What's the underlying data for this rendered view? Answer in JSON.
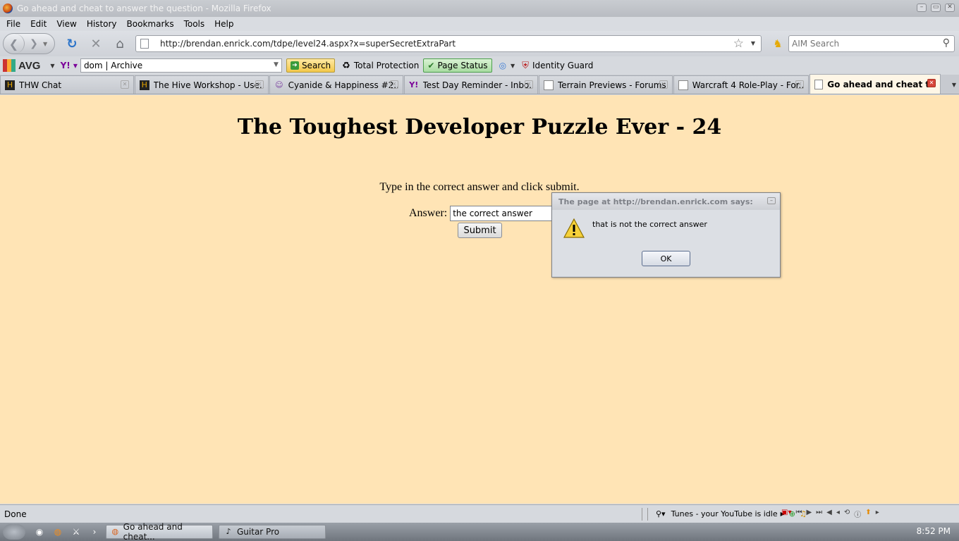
{
  "window": {
    "title": "Go ahead and cheat to answer the question - Mozilla Firefox",
    "controls": [
      "minimize",
      "restore",
      "close"
    ]
  },
  "menu": {
    "items": [
      "File",
      "Edit",
      "View",
      "History",
      "Bookmarks",
      "Tools",
      "Help"
    ]
  },
  "navbar": {
    "url": "http://brendan.enrick.com/tdpe/level24.aspx?x=superSecretExtraPart",
    "search_placeholder": "AIM Search"
  },
  "avgbar": {
    "brand": "AVG",
    "search_value": "dom | Archive",
    "search_button": "Search",
    "total_protection": "Total Protection",
    "page_status": "Page Status",
    "identity_guard": "Identity Guard"
  },
  "tabs": [
    {
      "label": "THW Chat",
      "icon": "hive-icon"
    },
    {
      "label": "The Hive Workshop - Use...",
      "icon": "hive-icon"
    },
    {
      "label": "Cyanide & Happiness #2...",
      "icon": "cyanide-icon"
    },
    {
      "label": "Test Day Reminder - Inbo...",
      "icon": "yahoo-icon"
    },
    {
      "label": "Terrain Previews - Forums",
      "icon": "page-icon"
    },
    {
      "label": "Warcraft 4 Role-Play - For...",
      "icon": "page-icon"
    },
    {
      "label": "Go ahead and cheat to a...",
      "icon": "page-icon",
      "active": true
    }
  ],
  "page": {
    "heading": "The Toughest Developer Puzzle Ever - 24",
    "instruction": "Type in the correct answer and click submit.",
    "answer_label": "Answer:",
    "answer_value": "the correct answer",
    "submit_label": "Submit",
    "background": "#ffe4b5"
  },
  "dialog": {
    "title": "The page at http://brendan.enrick.com says:",
    "message": "that is not the correct answer",
    "ok_label": "OK"
  },
  "statusbar": {
    "status": "Done",
    "youtube_text": "Tunes - your YouTube is idle"
  },
  "taskbar": {
    "tasks": [
      {
        "label": "Go ahead and cheat...",
        "active": true
      },
      {
        "label": "Guitar Pro",
        "active": false
      }
    ],
    "clock": "8:52 PM"
  }
}
